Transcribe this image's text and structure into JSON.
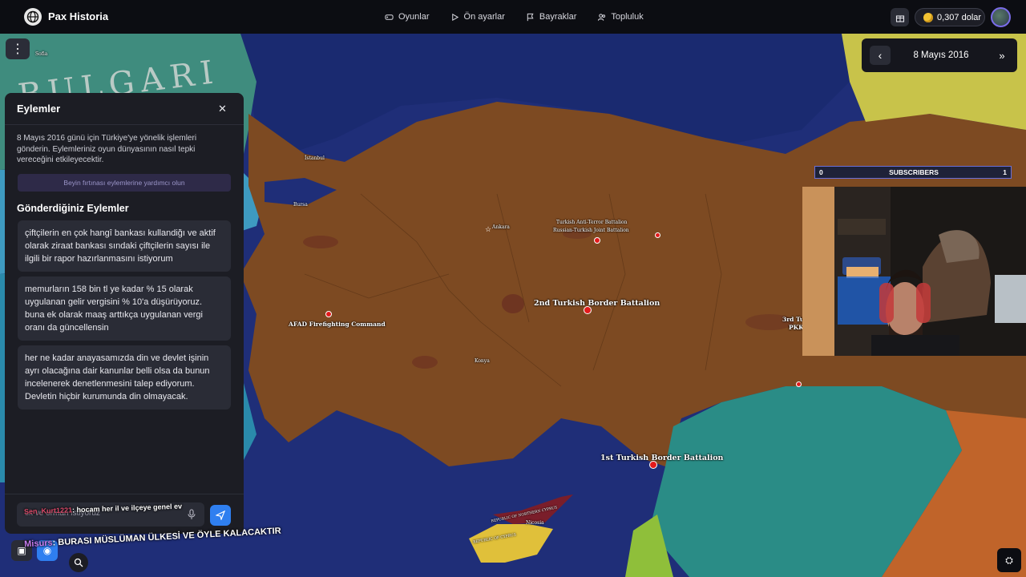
{
  "app": {
    "name": "Pax Historia"
  },
  "nav": [
    {
      "label": "Oyunlar",
      "icon": "gamepad-icon"
    },
    {
      "label": "Ön ayarlar",
      "icon": "play-icon"
    },
    {
      "label": "Bayraklar",
      "icon": "flag-icon"
    },
    {
      "label": "Topluluk",
      "icon": "users-icon"
    }
  ],
  "balance": {
    "label": "0,307 dolar"
  },
  "date": {
    "current": "8 Mayıs 2016"
  },
  "map": {
    "country_label": "BULGARI",
    "cities": {
      "sofia": "Sofia",
      "istanbul": "İstanbul",
      "bursa": "Bursa",
      "ankara": "Ankara",
      "konya": "Konya",
      "nicosia": "Nicosia"
    },
    "units": {
      "anti_terror": "Turkish Anti-Terror Battalion",
      "joint": "Russian-Turkish Joint Battalion",
      "border2": "2nd Turkish Border Battalion",
      "afad": "AFAD Firefighting Command",
      "border1": "1st Turkish Border Battalion",
      "border3": "3rd Tu",
      "pkk": "PKK"
    },
    "north_cyprus": "REPUBLIC OF NORTHERN CYPRUS",
    "cyprus": "REPUBLIC OF CYPRUS"
  },
  "panel": {
    "title": "Eylemler",
    "description": "8 Mayıs 2016 günü için Türkiye'ye yönelik işlemleri gönderin. Eylemleriniz oyun dünyasının nasıl tepki vereceğini etkileyecektir.",
    "brainstorm_label": "Beyin fırtınası eylemlerine yardımcı olun",
    "sent_title": "Gönderdiğiniz Eylemler",
    "actions": [
      "çiftçilerin en çok hangî bankası kullandiğ̀ı ve aktif olarak ziraat bankası sındaki çiftçilerin sayısı ile ilgili bir rapor hazırlanmasını istiyorum",
      "memurların 158 bin tl ye kadar % 15 olarak uygulanan gelir vergisini % 10'a düşürüyoruz. buna ek olarak maaş arttıkça uygulanan vergi oranı da güncellensin",
      "her ne kadar anayasamızda din ve devlet işinin ayrı olacağına dair kanunlar belli olsa da bunun incelenerek denetlenmesini talep ediyorum. Devletin hiçbir kurumunda din olmayacak."
    ],
    "input_value": "sit ve orman istiyoruz"
  },
  "chat": {
    "msg1_user": "Sen_Kurt1221",
    "msg1_text": ": hocam her il ve ilçeye genel ev",
    "msg2_user": "Misurs",
    "msg2_text": ": BURASI MÜSLÜMAN ÜLKESİ VE ÖYLE KALACAKTIR"
  },
  "stream": {
    "subs_min": "0",
    "subs_label": "SUBSCRIBERS",
    "subs_max": "1"
  },
  "colors": {
    "land": "#7d4a22",
    "sea": "#1f2e78",
    "syria": "#2a8c86",
    "accent": "#2f7ff0"
  }
}
